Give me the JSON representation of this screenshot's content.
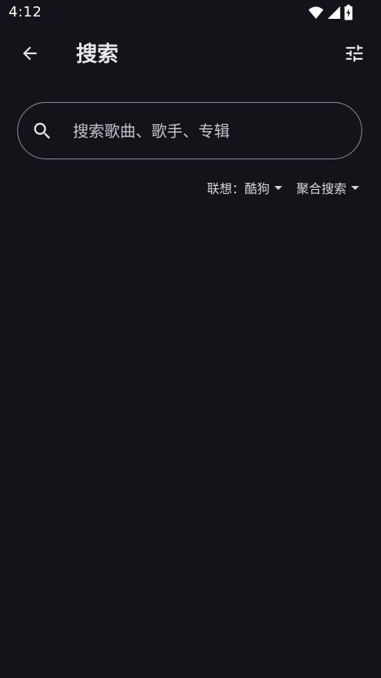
{
  "status_bar": {
    "time": "4:12",
    "icons": [
      "wifi-icon",
      "cellular-signal-icon",
      "battery-charging-icon"
    ]
  },
  "app_bar": {
    "back_icon": "arrow-left-icon",
    "title": "搜索",
    "filter_icon": "tune-sliders-icon"
  },
  "search": {
    "icon": "search-icon",
    "placeholder": "搜索歌曲、歌手、专辑",
    "value": ""
  },
  "options": {
    "suggest_label": "联想：酷狗",
    "search_mode_label": "聚合搜索"
  },
  "colors": {
    "background": "#131419",
    "text": "#e4e4ea",
    "outline": "#8d8f99"
  }
}
